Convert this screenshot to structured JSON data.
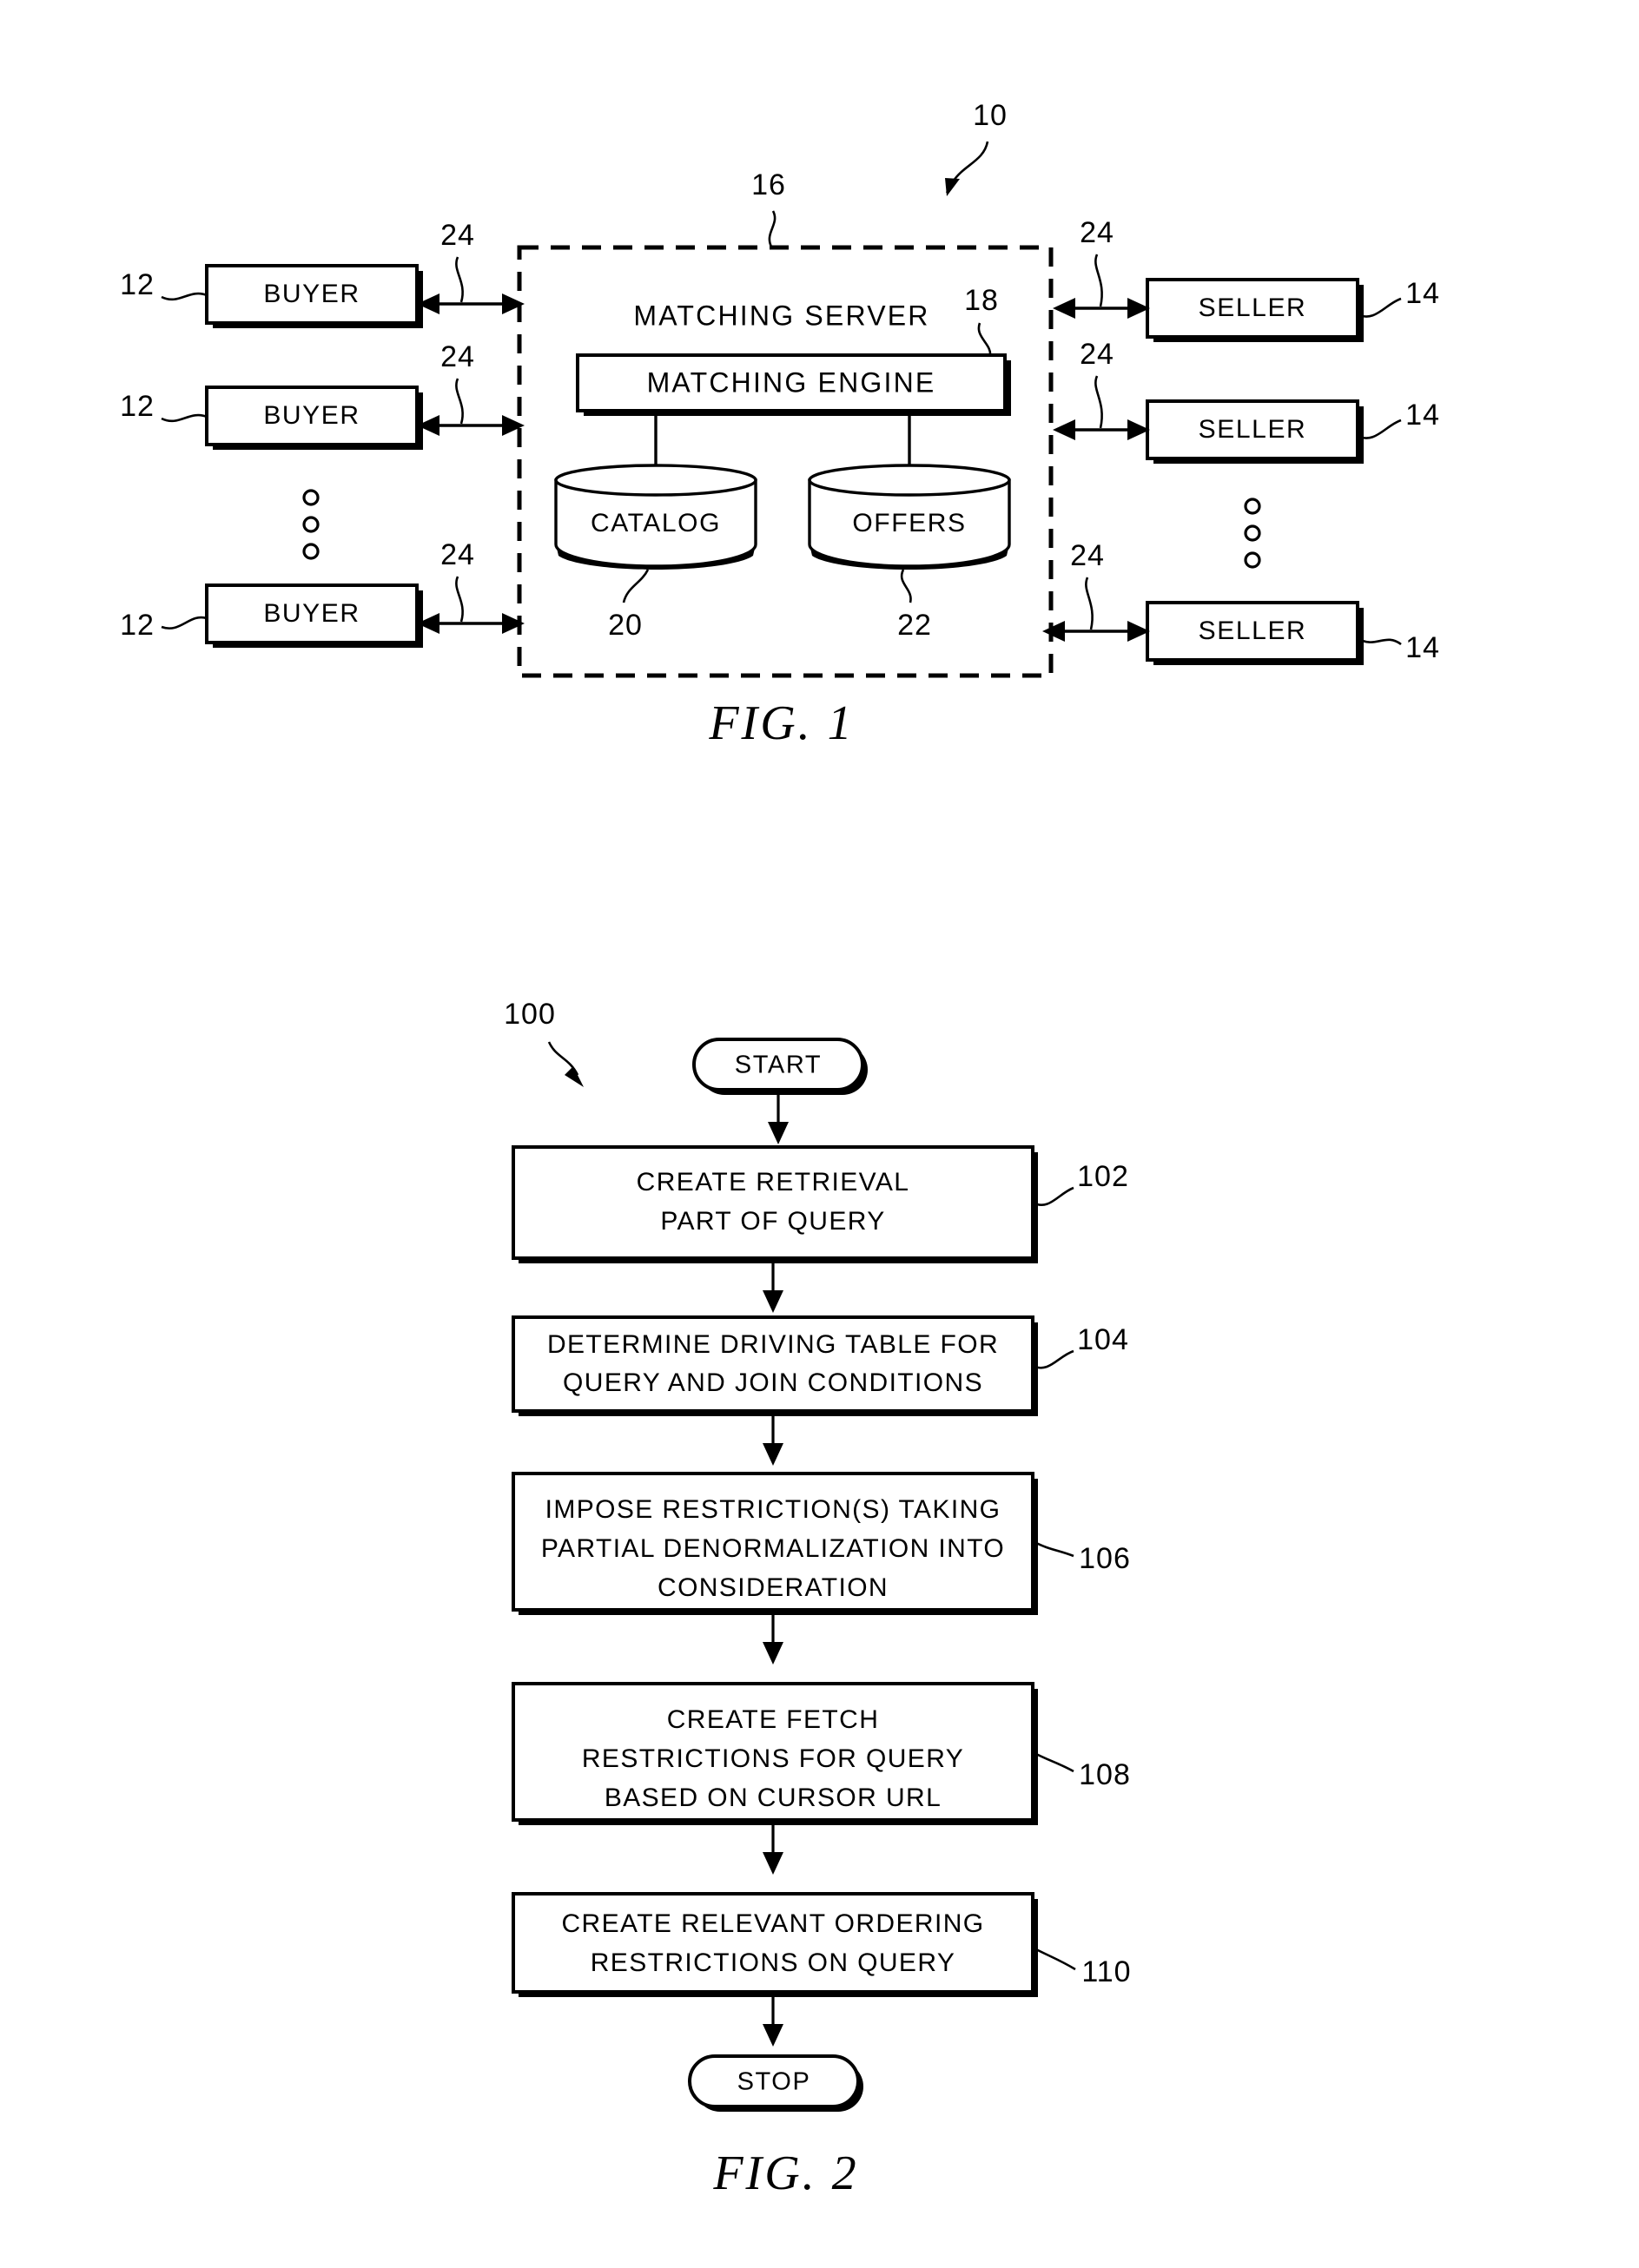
{
  "figures": [
    {
      "id": "fig1",
      "caption": "FIG.  1",
      "system_ref": "10",
      "nodes": {
        "buyers": [
          {
            "label": "BUYER",
            "ref": "12",
            "link_ref": "24"
          },
          {
            "label": "BUYER",
            "ref": "12",
            "link_ref": "24"
          },
          {
            "label": "BUYER",
            "ref": "12",
            "link_ref": "24"
          }
        ],
        "sellers": [
          {
            "label": "SELLER",
            "ref": "14",
            "link_ref": "24"
          },
          {
            "label": "SELLER",
            "ref": "14",
            "link_ref": "24"
          },
          {
            "label": "SELLER",
            "ref": "14",
            "link_ref": "24"
          }
        ],
        "server": {
          "label": "MATCHING SERVER",
          "ref": "16",
          "engine": {
            "label": "MATCHING ENGINE",
            "ref": "18"
          },
          "databases": [
            {
              "label": "CATALOG",
              "ref": "20"
            },
            {
              "label": "OFFERS",
              "ref": "22"
            }
          ]
        }
      }
    },
    {
      "id": "fig2",
      "caption": "FIG.  2",
      "process_ref": "100",
      "terminators": {
        "start": "START",
        "stop": "STOP"
      },
      "steps": [
        {
          "ref": "102",
          "lines": [
            "CREATE RETRIEVAL",
            "PART OF QUERY"
          ]
        },
        {
          "ref": "104",
          "lines": [
            "DETERMINE DRIVING TABLE FOR",
            "QUERY AND JOIN CONDITIONS"
          ]
        },
        {
          "ref": "106",
          "lines": [
            "IMPOSE RESTRICTION(S) TAKING",
            "PARTIAL DENORMALIZATION INTO",
            "CONSIDERATION"
          ]
        },
        {
          "ref": "108",
          "lines": [
            "CREATE FETCH",
            "RESTRICTIONS FOR QUERY",
            "BASED ON CURSOR URL"
          ]
        },
        {
          "ref": "110",
          "lines": [
            "CREATE RELEVANT ORDERING",
            "RESTRICTIONS ON QUERY"
          ]
        }
      ]
    }
  ],
  "colors": {
    "ink": "#000000",
    "paper": "#ffffff"
  }
}
